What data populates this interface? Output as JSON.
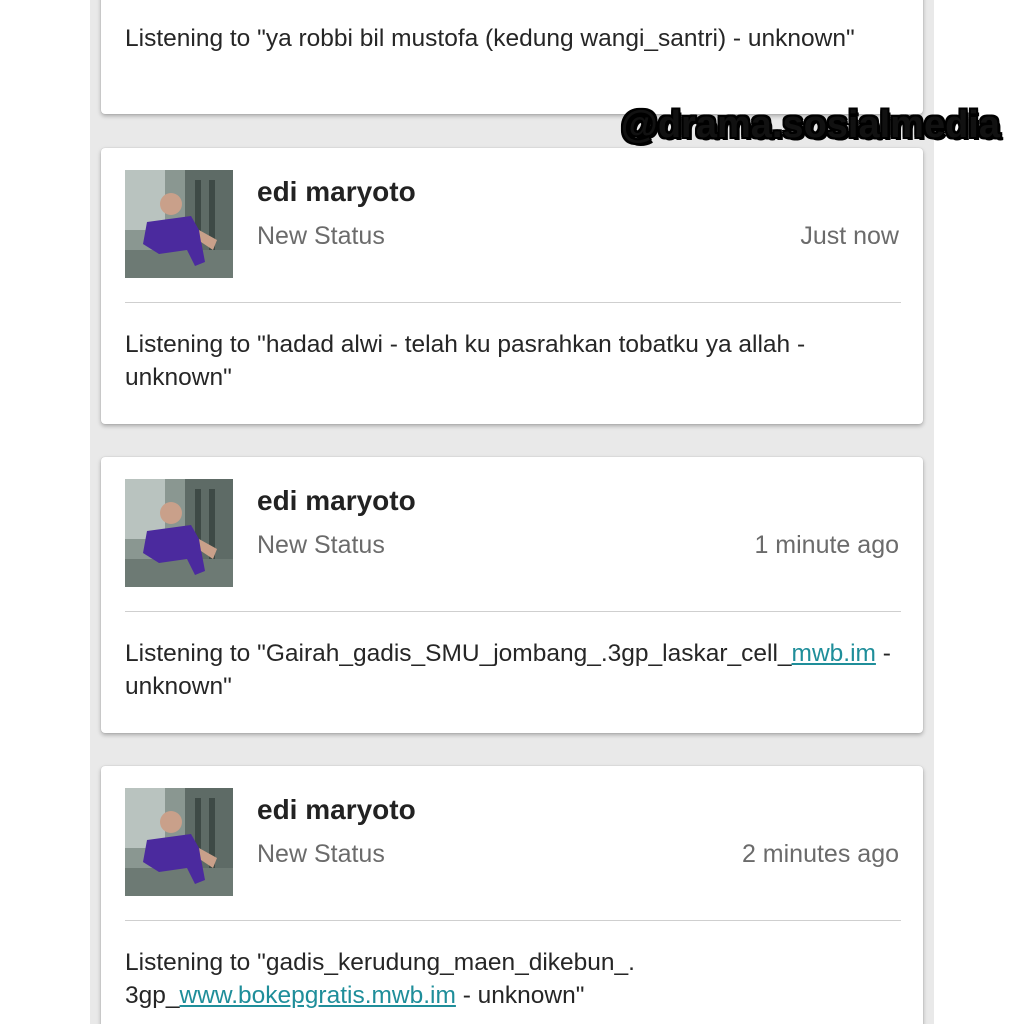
{
  "watermark": "@drama.sosialmedia",
  "top_card": {
    "text": "Listening to \"ya robbi bil mustofa (kedung wangi_santri) - unknown\""
  },
  "posts": [
    {
      "name": "edi maryoto",
      "subtitle": "New Status",
      "time": "Just now",
      "text": "Listening to \"hadad alwi - telah ku pasrahkan tobatku ya allah - unknown\""
    },
    {
      "name": "edi maryoto",
      "subtitle": "New Status",
      "time": "1 minute ago",
      "text_before": "Listening to \"Gairah_gadis_SMU_jombang_.​3gp_laskar_cell_",
      "link": "mwb.im",
      "text_after": " - unknown\""
    },
    {
      "name": "edi maryoto",
      "subtitle": "New Status",
      "time": "2 minutes ago",
      "text_before": "Listening to \"gadis_kerudung_maen_dikebun_.​3gp_",
      "link": "www.bokepgratis.mwb.im",
      "text_after": " - unknown\""
    }
  ],
  "colors": {
    "link": "#1f8e9a",
    "feed_background": "#e9e9e9",
    "avatar_shirt": "#4b2a9e"
  },
  "icons": {
    "avatar": "user-photo-avatar"
  }
}
